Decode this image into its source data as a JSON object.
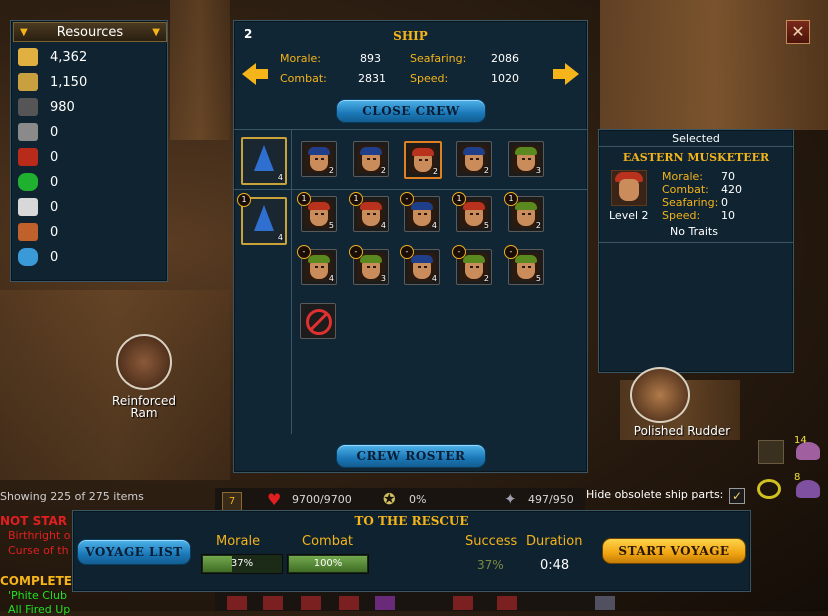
{
  "resources": {
    "title": "Resources",
    "items": [
      {
        "icon": "gold-coins-icon",
        "value": "4,362"
      },
      {
        "icon": "timber-bundle-icon",
        "value": "1,150"
      },
      {
        "icon": "ore-pile-icon",
        "value": "980"
      },
      {
        "icon": "iron-ingot-icon",
        "value": "0"
      },
      {
        "icon": "red-barrel-icon",
        "value": "0"
      },
      {
        "icon": "green-gem-icon",
        "value": "0"
      },
      {
        "icon": "silver-bar-icon",
        "value": "0"
      },
      {
        "icon": "copper-scrap-icon",
        "value": "0"
      },
      {
        "icon": "blue-crystal-icon",
        "value": "0"
      }
    ]
  },
  "ship": {
    "number": "2",
    "title": "SHIP",
    "morale_label": "Morale:",
    "morale": "893",
    "combat_label": "Combat:",
    "combat": "2831",
    "seafaring_label": "Seafaring:",
    "seafaring": "2086",
    "speed_label": "Speed:",
    "speed": "1020",
    "close_crew": "CLOSE CREW",
    "crew_roster": "CREW ROSTER"
  },
  "crew": {
    "assigned": [
      {
        "level": "4",
        "band": "#1f3f8a"
      },
      {
        "level": "2",
        "band": "#1f3f8a"
      },
      {
        "level": "2",
        "band": "#1f3f8a"
      },
      {
        "level": "2",
        "band": "#b8321e"
      },
      {
        "level": "2",
        "band": "#1f3f8a"
      },
      {
        "level": "3",
        "band": "#5a8a1f"
      }
    ],
    "roster_row1": [
      {
        "badge": "1",
        "level": "4",
        "band": "#1f3f8a"
      },
      {
        "badge": "1",
        "level": "5",
        "band": "#b8321e"
      },
      {
        "badge": "1",
        "level": "4",
        "band": "#b8321e"
      },
      {
        "badge": "-",
        "level": "4",
        "band": "#1f3f8a"
      },
      {
        "badge": "1",
        "level": "5",
        "band": "#b8321e"
      },
      {
        "badge": "1",
        "level": "2",
        "band": "#5a8a1f"
      }
    ],
    "roster_row2": [
      {
        "badge": "-",
        "level": "4",
        "band": "#5a8a1f"
      },
      {
        "badge": "-",
        "level": "3",
        "band": "#5a8a1f"
      },
      {
        "badge": "-",
        "level": "4",
        "band": "#1f3f8a"
      },
      {
        "badge": "-",
        "level": "2",
        "band": "#5a8a1f"
      },
      {
        "badge": "-",
        "level": "5",
        "band": "#5a8a1f"
      }
    ]
  },
  "selected": {
    "heading": "Selected",
    "name": "EASTERN MUSKETEER",
    "level": "Level 2",
    "morale_label": "Morale:",
    "morale": "70",
    "combat_label": "Combat:",
    "combat": "420",
    "seafaring_label": "Seafaring:",
    "seafaring": "0",
    "speed_label": "Speed:",
    "speed": "10",
    "traits": "No Traits"
  },
  "world": {
    "reinforced_ram": "Reinforced\nRam",
    "polished_rudder": "Polished Rudder",
    "showing": "Showing 225 of 275 items",
    "not_started": "NOT STAR",
    "quest1": "Birthright o",
    "quest2": "Curse of th",
    "completed": "COMPLETE",
    "done1": "'Phite Club",
    "done2": "All Fired Up",
    "hide_obsolete": "Hide obsolete ship parts:",
    "hp": "9700/9700",
    "prayer": "0%",
    "summon": "497/950",
    "inv_count1": "14",
    "inv_count2": "8",
    "bottom_num": "7"
  },
  "voyage": {
    "title": "TO THE RESCUE",
    "voyage_list": "VOYAGE LIST",
    "morale_label": "Morale",
    "morale_pct": "37%",
    "morale_fill": 0.37,
    "combat_label": "Combat",
    "combat_pct": "100%",
    "combat_fill": 1.0,
    "success_label": "Success",
    "success": "37%",
    "duration_label": "Duration",
    "duration": "0:48",
    "start": "START VOYAGE"
  }
}
